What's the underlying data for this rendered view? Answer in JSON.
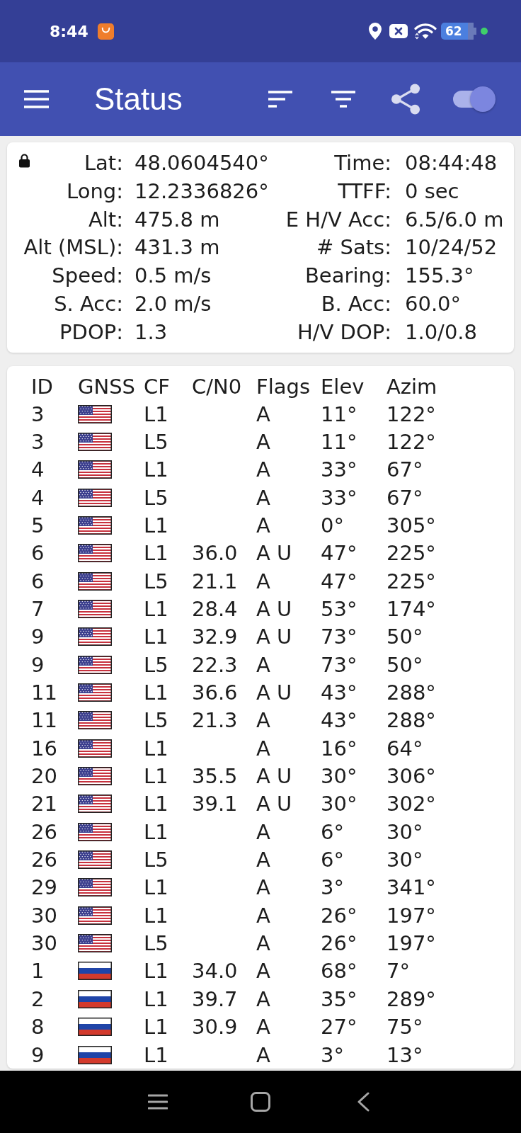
{
  "status_bar": {
    "time": "8:44",
    "battery": "62"
  },
  "app_bar": {
    "title": "Status",
    "toggle": {
      "on": true
    }
  },
  "fix_card": {
    "locked": true,
    "rows": [
      {
        "left": {
          "label": "Lat:",
          "value": "48.0604540°"
        },
        "right": {
          "label": "Time:",
          "value": "08:44:48"
        }
      },
      {
        "left": {
          "label": "Long:",
          "value": "12.2336826°"
        },
        "right": {
          "label": "TTFF:",
          "value": "0 sec"
        }
      },
      {
        "left": {
          "label": "Alt:",
          "value": "475.8 m"
        },
        "right": {
          "label": "E H/V Acc:",
          "value": "6.5/6.0 m"
        }
      },
      {
        "left": {
          "label": "Alt (MSL):",
          "value": "431.3 m"
        },
        "right": {
          "label": "# Sats:",
          "value": "10/24/52"
        }
      },
      {
        "left": {
          "label": "Speed:",
          "value": "0.5 m/s"
        },
        "right": {
          "label": "Bearing:",
          "value": "155.3°"
        }
      },
      {
        "left": {
          "label": "S. Acc:",
          "value": "2.0 m/s"
        },
        "right": {
          "label": "B. Acc:",
          "value": "60.0°"
        }
      },
      {
        "left": {
          "label": "PDOP:",
          "value": "1.3"
        },
        "right": {
          "label": "H/V DOP:",
          "value": "1.0/0.8"
        }
      }
    ]
  },
  "satellite_table": {
    "columns": [
      "ID",
      "GNSS",
      "CF",
      "C/N0",
      "Flags",
      "Elev",
      "Azim"
    ],
    "rows": [
      {
        "id": "3",
        "kind": "usa",
        "cf": "L1",
        "flags": "A",
        "elev": "11°",
        "azim": "122°"
      },
      {
        "id": "3",
        "kind": "usa",
        "cf": "L5",
        "flags": "A",
        "elev": "11°",
        "azim": "122°"
      },
      {
        "id": "4",
        "kind": "usa",
        "cf": "L1",
        "flags": "A",
        "elev": "33°",
        "azim": "67°"
      },
      {
        "id": "4",
        "kind": "usa",
        "cf": "L5",
        "flags": "A",
        "elev": "33°",
        "azim": "67°"
      },
      {
        "id": "5",
        "kind": "usa",
        "cf": "L1",
        "flags": "A",
        "elev": "0°",
        "azim": "305°"
      },
      {
        "id": "6",
        "kind": "usa",
        "cf": "L1",
        "cn0": "36.0",
        "flags": "A U",
        "elev": "47°",
        "azim": "225°"
      },
      {
        "id": "6",
        "kind": "usa",
        "cf": "L5",
        "cn0": "21.1",
        "flags": "A",
        "elev": "47°",
        "azim": "225°"
      },
      {
        "id": "7",
        "kind": "usa",
        "cf": "L1",
        "cn0": "28.4",
        "flags": "A U",
        "elev": "53°",
        "azim": "174°"
      },
      {
        "id": "9",
        "kind": "usa",
        "cf": "L1",
        "cn0": "32.9",
        "flags": "A U",
        "elev": "73°",
        "azim": "50°"
      },
      {
        "id": "9",
        "kind": "usa",
        "cf": "L5",
        "cn0": "22.3",
        "flags": "A",
        "elev": "73°",
        "azim": "50°"
      },
      {
        "id": "11",
        "kind": "usa",
        "cf": "L1",
        "cn0": "36.6",
        "flags": "A U",
        "elev": "43°",
        "azim": "288°"
      },
      {
        "id": "11",
        "kind": "usa",
        "cf": "L5",
        "cn0": "21.3",
        "flags": "A",
        "elev": "43°",
        "azim": "288°"
      },
      {
        "id": "16",
        "kind": "usa",
        "cf": "L1",
        "flags": "A",
        "elev": "16°",
        "azim": "64°"
      },
      {
        "id": "20",
        "kind": "usa",
        "cf": "L1",
        "cn0": "35.5",
        "flags": "A U",
        "elev": "30°",
        "azim": "306°"
      },
      {
        "id": "21",
        "kind": "usa",
        "cf": "L1",
        "cn0": "39.1",
        "flags": "A U",
        "elev": "30°",
        "azim": "302°"
      },
      {
        "id": "26",
        "kind": "usa",
        "cf": "L1",
        "flags": "A",
        "elev": "6°",
        "azim": "30°"
      },
      {
        "id": "26",
        "kind": "usa",
        "cf": "L5",
        "flags": "A",
        "elev": "6°",
        "azim": "30°"
      },
      {
        "id": "29",
        "kind": "usa",
        "cf": "L1",
        "flags": "A",
        "elev": "3°",
        "azim": "341°"
      },
      {
        "id": "30",
        "kind": "usa",
        "cf": "L1",
        "flags": "A",
        "elev": "26°",
        "azim": "197°"
      },
      {
        "id": "30",
        "kind": "usa",
        "cf": "L5",
        "flags": "A",
        "elev": "26°",
        "azim": "197°"
      },
      {
        "id": "1",
        "kind": "russia",
        "cf": "L1",
        "cn0": "34.0",
        "flags": "A",
        "elev": "68°",
        "azim": "7°"
      },
      {
        "id": "2",
        "kind": "russia",
        "cf": "L1",
        "cn0": "39.7",
        "flags": "A",
        "elev": "35°",
        "azim": "289°"
      },
      {
        "id": "8",
        "kind": "russia",
        "cf": "L1",
        "cn0": "30.9",
        "flags": "A",
        "elev": "27°",
        "azim": "75°"
      },
      {
        "id": "9",
        "kind": "russia",
        "cf": "L1",
        "flags": "A",
        "elev": "3°",
        "azim": "13°"
      }
    ]
  }
}
